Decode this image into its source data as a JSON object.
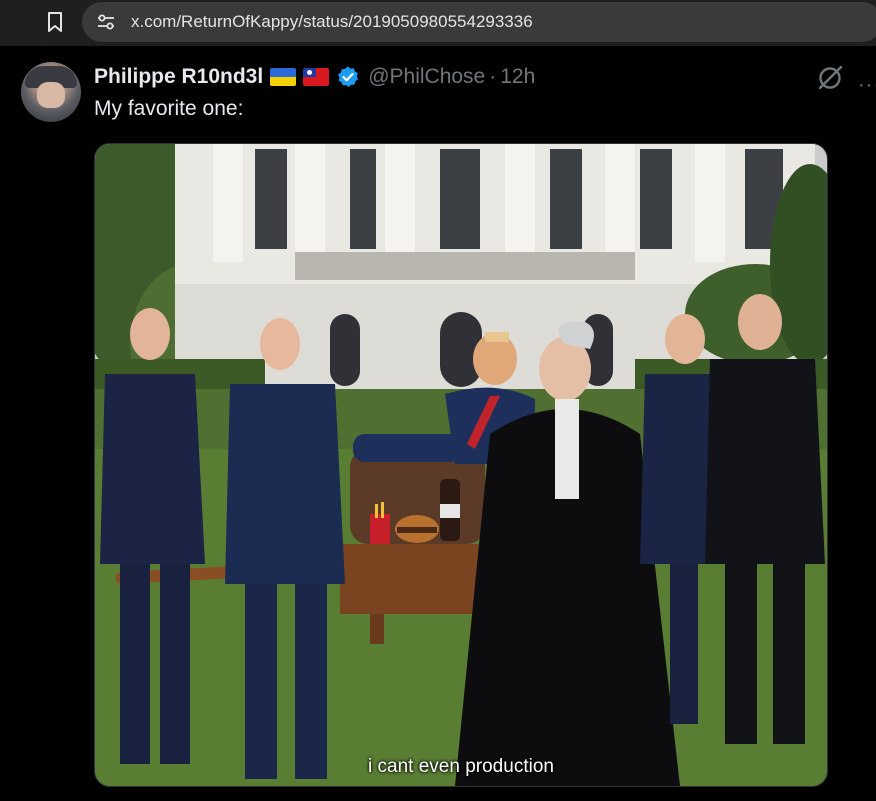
{
  "browser": {
    "url": "x.com/ReturnOfKappy/status/2019050980554293336",
    "bookmark_icon": "bookmark-icon",
    "site_info_icon": "tune-icon"
  },
  "tweet": {
    "display_name": "Philippe R10nd3l",
    "flags": [
      "ukraine-flag",
      "taiwan-flag"
    ],
    "verified": true,
    "handle": "@PhilChose",
    "separator": "·",
    "time": "12h",
    "text": "My favorite one:",
    "more_label": "···",
    "media": {
      "caption": "i cant even production",
      "alt": "White House lawn scene photo"
    }
  },
  "colors": {
    "background": "#000000",
    "text": "#e7e9ea",
    "muted": "#71767b",
    "verified": "#1d9bf0",
    "browser_bar": "#1f1f1f",
    "url_box": "#3a3a3a"
  }
}
